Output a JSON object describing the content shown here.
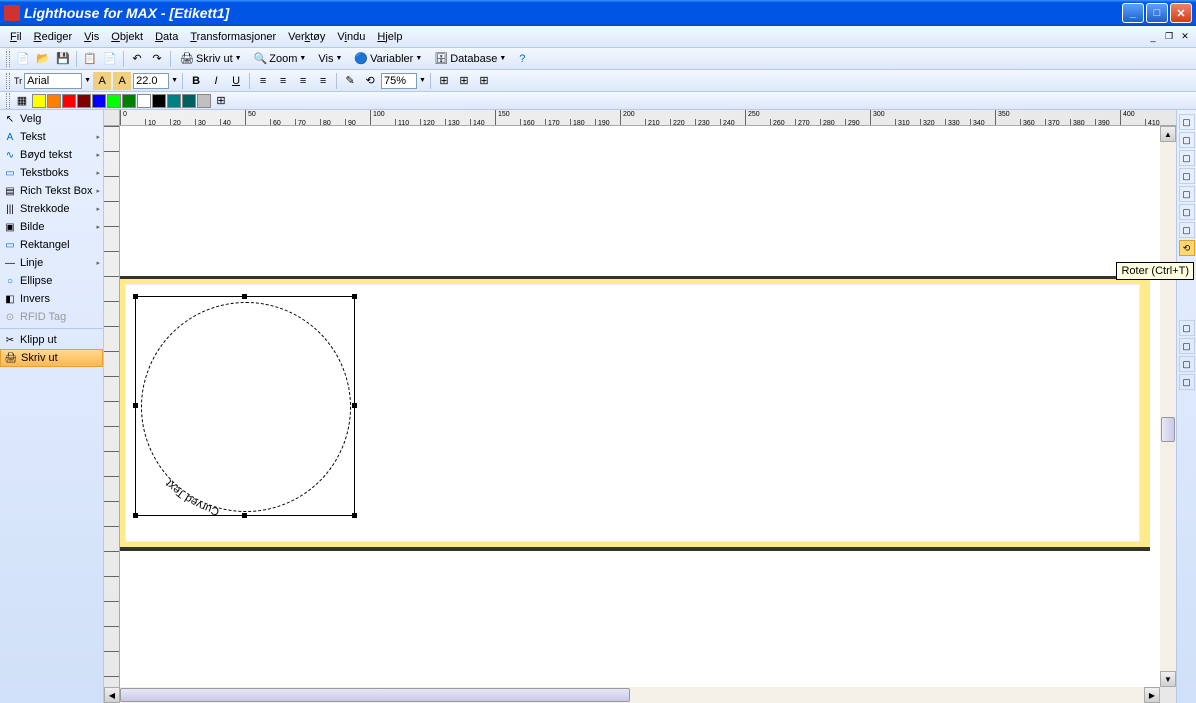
{
  "window": {
    "title": "Lighthouse for MAX - [Etikett1]"
  },
  "menu": {
    "fil": "Fil",
    "rediger": "Rediger",
    "vis": "Vis",
    "objekt": "Objekt",
    "data": "Data",
    "transformasjoner": "Transformasjoner",
    "verktoy": "Verktøy",
    "vindu": "Vindu",
    "hjelp": "Hjelp"
  },
  "toolbar1": {
    "skrivut": "Skriv ut",
    "zoom": "Zoom",
    "vis": "Vis",
    "variabler": "Variabler",
    "database": "Database"
  },
  "toolbar2": {
    "font": "Arial",
    "size": "22.0",
    "zoom_pct": "75%"
  },
  "tools": {
    "velg": "Velg",
    "tekst": "Tekst",
    "boyd": "Bøyd tekst",
    "tekstboks": "Tekstboks",
    "rich": "Rich Tekst Box",
    "strekkode": "Strekkode",
    "bilde": "Bilde",
    "rektangel": "Rektangel",
    "linje": "Linje",
    "ellipse": "Ellipse",
    "invers": "Invers",
    "rfid": "RFID Tag",
    "klipp": "Klipp ut",
    "skriv": "Skriv ut"
  },
  "canvas": {
    "curved_text": "Curved Text"
  },
  "tooltip": {
    "rotate": "Roter (Ctrl+T)"
  },
  "colors": {
    "yellow": "#ffff00",
    "orange": "#ff8000",
    "red": "#ff0000",
    "darkred": "#800000",
    "blue": "#0000ff",
    "green": "#00ff00",
    "darkgreen": "#008000",
    "white": "#ffffff",
    "black": "#000000",
    "teal": "#008080",
    "dteal": "#006060",
    "gray": "#c0c0c0"
  }
}
